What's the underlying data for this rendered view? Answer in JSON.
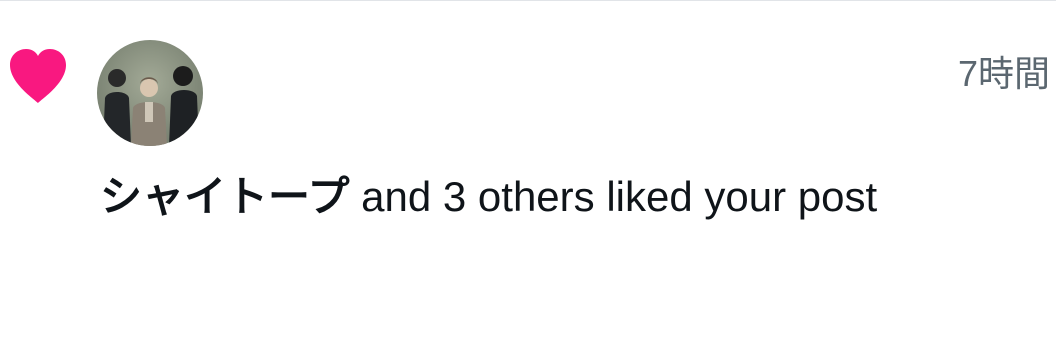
{
  "notification": {
    "icon": "heart-icon",
    "icon_color": "#f91880",
    "avatar": "group-photo-avatar",
    "timestamp": "7時間",
    "username": "シャイトープ",
    "message_rest": " and 3 others liked your post"
  }
}
